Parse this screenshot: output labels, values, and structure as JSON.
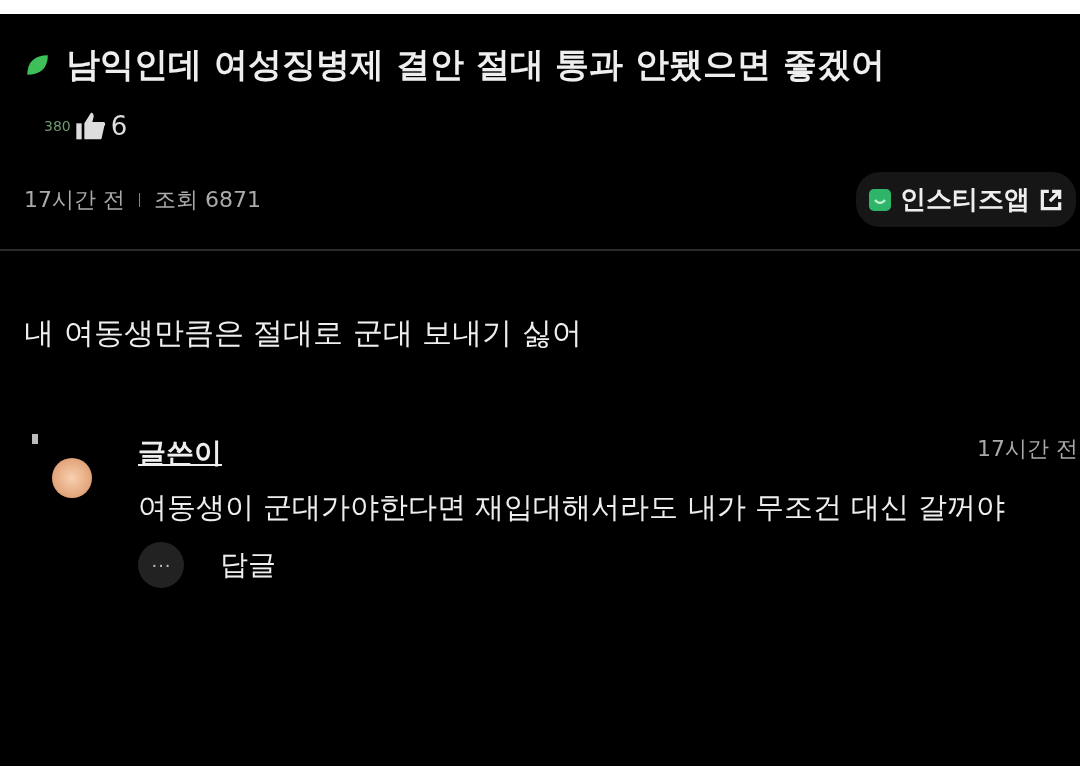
{
  "post": {
    "title": "남익인데 여성징병제 결안 절대 통과 안됐으면 좋겠어",
    "level": "380",
    "likes": "6",
    "time": "17시간 전",
    "views": "조회 6871",
    "app_link": "인스티즈앱",
    "body": "내 여동생만큼은 절대로 군대 보내기 싫어"
  },
  "comments": [
    {
      "author": "글쓴이",
      "time": "17시간 전",
      "text": "여동생이 군대가야한다면 재입대해서라도 내가 무조건 대신 갈꺼야",
      "more": "···",
      "reply": "답글"
    }
  ]
}
